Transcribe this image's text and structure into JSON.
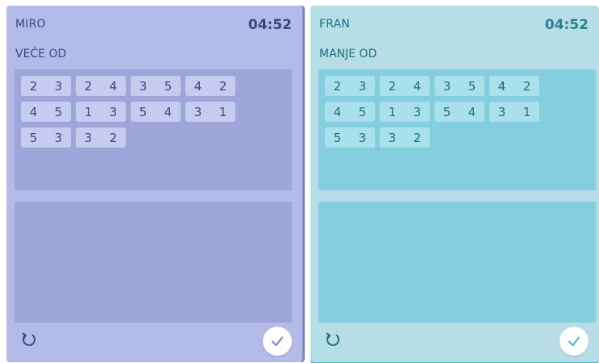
{
  "colors": {
    "left_panel_bg": "#b5bbe8",
    "left_accent": "#3e4684",
    "right_panel_bg": "#b7dde6",
    "right_accent": "#1f6e86",
    "check_color_left": "#7f86c6",
    "check_color_right": "#4fb7cc"
  },
  "panels": [
    {
      "player": "MIRO",
      "timer": "04:52",
      "task": "VEĆE OD",
      "pairs": [
        {
          "a": "2",
          "b": "3"
        },
        {
          "a": "2",
          "b": "4"
        },
        {
          "a": "3",
          "b": "5"
        },
        {
          "a": "4",
          "b": "2"
        },
        {
          "a": "4",
          "b": "5"
        },
        {
          "a": "1",
          "b": "3"
        },
        {
          "a": "5",
          "b": "4"
        },
        {
          "a": "3",
          "b": "1"
        },
        {
          "a": "5",
          "b": "3"
        },
        {
          "a": "3",
          "b": "2"
        }
      ],
      "icons": {
        "reset": "refresh-icon",
        "confirm": "checkmark-icon"
      }
    },
    {
      "player": "FRAN",
      "timer": "04:52",
      "task": "MANJE OD",
      "pairs": [
        {
          "a": "2",
          "b": "3"
        },
        {
          "a": "2",
          "b": "4"
        },
        {
          "a": "3",
          "b": "5"
        },
        {
          "a": "4",
          "b": "2"
        },
        {
          "a": "4",
          "b": "5"
        },
        {
          "a": "1",
          "b": "3"
        },
        {
          "a": "5",
          "b": "4"
        },
        {
          "a": "3",
          "b": "1"
        },
        {
          "a": "5",
          "b": "3"
        },
        {
          "a": "3",
          "b": "2"
        }
      ],
      "icons": {
        "reset": "refresh-icon",
        "confirm": "checkmark-icon"
      }
    }
  ]
}
